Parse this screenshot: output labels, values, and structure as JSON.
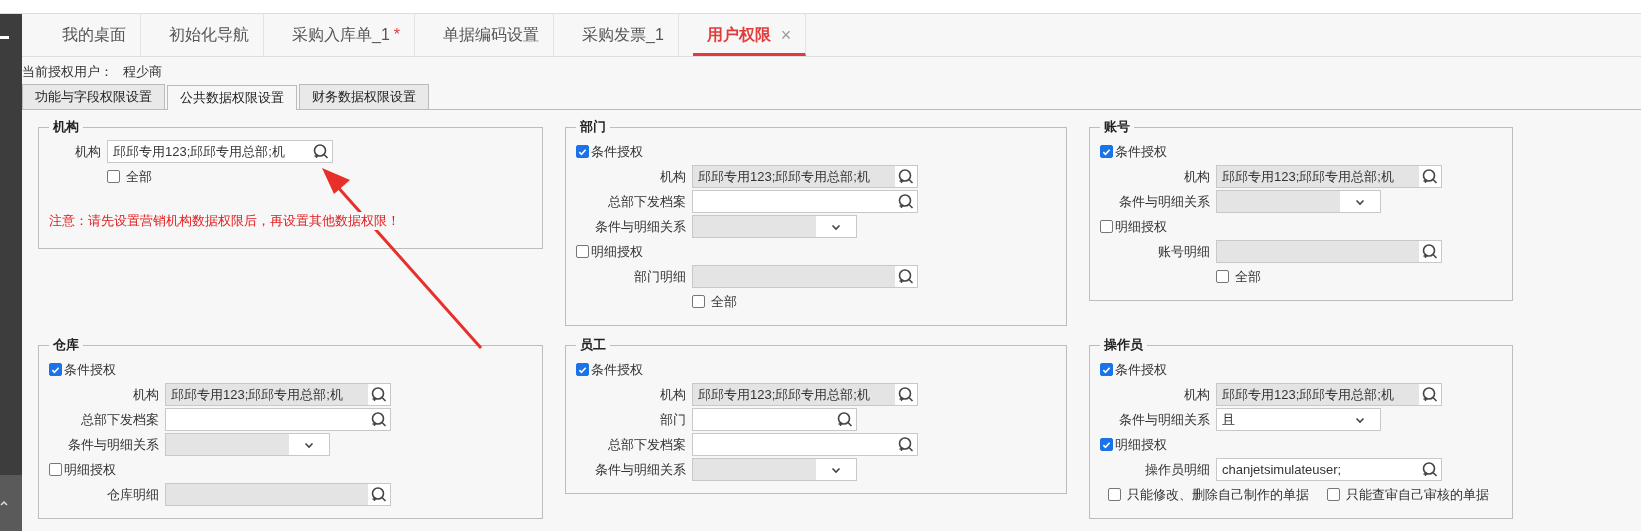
{
  "tabs": [
    {
      "label": "我的桌面",
      "selected": false
    },
    {
      "label": "初始化导航",
      "selected": false
    },
    {
      "label": "采购入库单_1",
      "marker": "*",
      "selected": false
    },
    {
      "label": "单据编码设置",
      "selected": false
    },
    {
      "label": "采购发票_1",
      "selected": false
    },
    {
      "label": "用户权限",
      "close": "×",
      "selected": true
    }
  ],
  "current_user": {
    "label": "当前授权用户：",
    "value": "程少商"
  },
  "subtabs": [
    {
      "label": "功能与字段权限设置",
      "selected": false
    },
    {
      "label": "公共数据权限设置",
      "selected": true
    },
    {
      "label": "财务数据权限设置",
      "selected": false
    }
  ],
  "sections": [
    {
      "title": "机构",
      "kind": "basic",
      "items": [
        {
          "kind": "lookup",
          "label": "机构",
          "value": "邱邱专用123;邱邱专用总部;机",
          "disabled": false
        },
        {
          "kind": "all",
          "label": "全部",
          "checked": false
        },
        {
          "kind": "note",
          "text": "注意：请先设置营销机构数据权限后，再设置其他数据权限！"
        }
      ]
    },
    {
      "title": "部门",
      "kind": "conditional",
      "items": [
        {
          "kind": "check",
          "label": "条件授权",
          "checked": true
        },
        {
          "kind": "lookup",
          "label": "机构",
          "value": "邱邱专用123;邱邱专用总部;机",
          "disabled": true
        },
        {
          "kind": "lookup",
          "label": "总部下发档案",
          "disabled": false
        },
        {
          "kind": "select",
          "label": "条件与明细关系",
          "disabled": true
        },
        {
          "kind": "check",
          "label": "明细授权",
          "checked": false
        },
        {
          "kind": "lookup",
          "label": "部门明细",
          "disabled": true
        },
        {
          "kind": "all",
          "label": "全部",
          "checked": false
        }
      ]
    },
    {
      "title": "账号",
      "kind": "conditional",
      "items": [
        {
          "kind": "check",
          "label": "条件授权",
          "checked": true
        },
        {
          "kind": "lookup",
          "label": "机构",
          "value": "邱邱专用123;邱邱专用总部;机",
          "disabled": true
        },
        {
          "kind": "select",
          "label": "条件与明细关系",
          "disabled": true
        },
        {
          "kind": "check",
          "label": "明细授权",
          "checked": false
        },
        {
          "kind": "lookup",
          "label": "账号明细",
          "disabled": true
        },
        {
          "kind": "all",
          "label": "全部",
          "checked": false
        }
      ]
    },
    {
      "title": "仓库",
      "kind": "conditional",
      "items": [
        {
          "kind": "check",
          "label": "条件授权",
          "checked": true
        },
        {
          "kind": "lookup",
          "label": "机构",
          "value": "邱邱专用123;邱邱专用总部;机",
          "disabled": true
        },
        {
          "kind": "lookup",
          "label": "总部下发档案",
          "disabled": false
        },
        {
          "kind": "select",
          "label": "条件与明细关系",
          "disabled": true
        },
        {
          "kind": "check",
          "label": "明细授权",
          "checked": false
        },
        {
          "kind": "lookup",
          "label": "仓库明细",
          "disabled": true
        }
      ]
    },
    {
      "title": "员工",
      "kind": "conditional",
      "items": [
        {
          "kind": "check",
          "label": "条件授权",
          "checked": true
        },
        {
          "kind": "lookup",
          "label": "机构",
          "value": "邱邱专用123;邱邱专用总部;机",
          "disabled": true
        },
        {
          "kind": "shortlookup",
          "label": "部门",
          "disabled": false
        },
        {
          "kind": "lookup",
          "label": "总部下发档案",
          "disabled": false
        },
        {
          "kind": "select",
          "label": "条件与明细关系",
          "disabled": true
        }
      ]
    },
    {
      "title": "操作员",
      "kind": "conditional",
      "items": [
        {
          "kind": "check",
          "label": "条件授权",
          "checked": true
        },
        {
          "kind": "lookup",
          "label": "机构",
          "value": "邱邱专用123;邱邱专用总部;机",
          "disabled": true
        },
        {
          "kind": "select",
          "label": "条件与明细关系",
          "value": "且",
          "disabled": false
        },
        {
          "kind": "check",
          "label": "明细授权",
          "checked": true
        },
        {
          "kind": "lookup",
          "label": "操作员明细",
          "value": "chanjetsimulateuser;",
          "disabled": false
        },
        {
          "kind": "checkpair",
          "options": [
            {
              "label": "只能修改、删除自己制作的单据",
              "checked": false
            },
            {
              "label": "只能查审自己审核的单据",
              "checked": false
            }
          ]
        }
      ]
    }
  ]
}
